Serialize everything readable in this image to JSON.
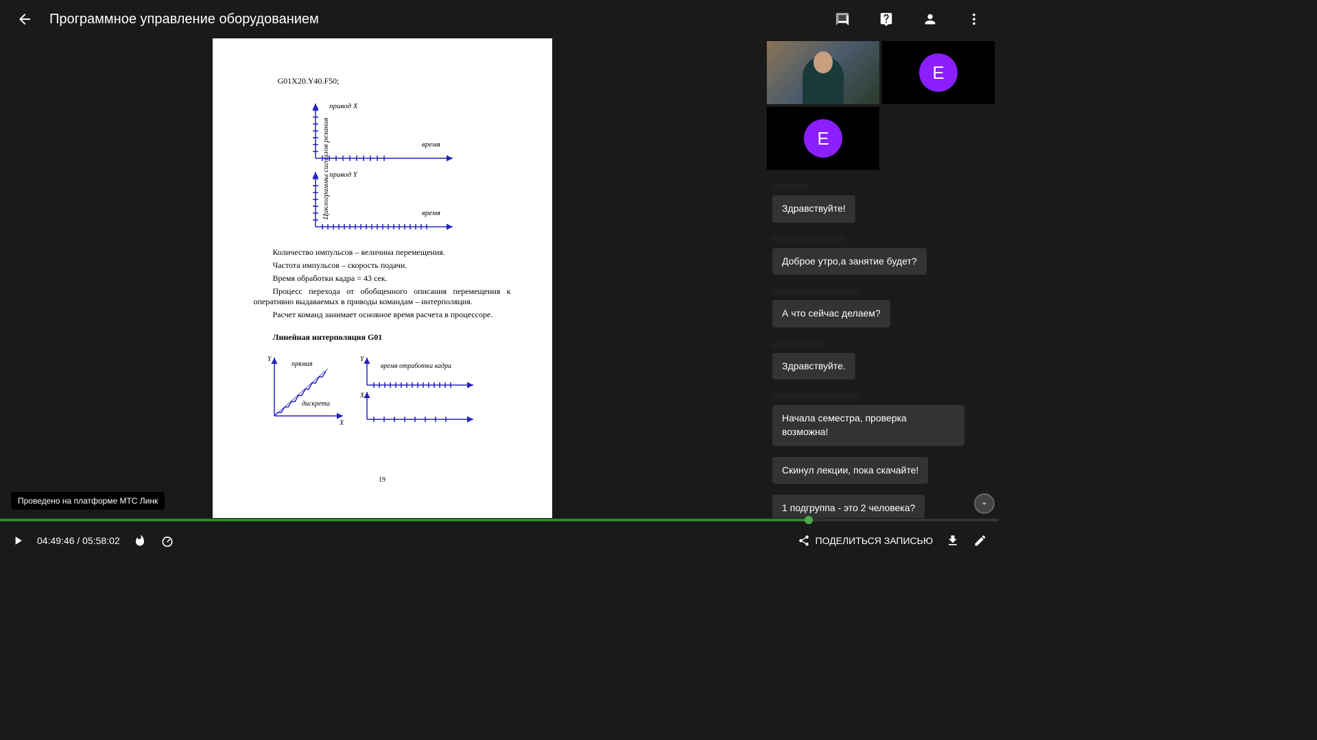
{
  "header": {
    "title": "Программное управление оборудованием"
  },
  "document": {
    "code_line": "G01X20.Y40.F50;",
    "vert_label": "Циклограммы сигналов резания",
    "axis_top_label": "привод Х",
    "axis_bottom_label": "привод Y",
    "axis_time": "время",
    "text1": "Количество импульсов – величина перемещения.",
    "text2": "Частота импульсов – скорость подачи.",
    "text3": "Время обработки кадра = 43 сек.",
    "text4": "Процесс перехода от обобщенного описания перемещения к оперативно выдаваемых в приводы командам – интерполяция.",
    "text5": "Расчет команд занимает основное время расчета в процессоре.",
    "heading": "Линейная интерполяция G01",
    "d2_label1": "прямая",
    "d2_label2": "дискрета",
    "d2_label3": "время отработки кадра",
    "page_number": "19"
  },
  "platform_badge": "Проведено на платформе МТС Линк",
  "participants": {
    "avatar_letter": "Е"
  },
  "chat": [
    {
      "name": "————",
      "text": "Здравствуйте!"
    },
    {
      "name": "————————",
      "text": "Доброе утро,а занятие будет?"
    },
    {
      "name": "——————————",
      "text": "А что сейчас делаем?"
    },
    {
      "name": "——————",
      "text": "Здравствуйте."
    },
    {
      "name": "——————————",
      "text": "Начала семестра, проверка возможна!"
    },
    {
      "name": "",
      "text": "Скинул лекции, пока скачайте!"
    },
    {
      "name": "",
      "text": "1 подгруппа - это 2 человека?"
    }
  ],
  "controls": {
    "current_time": "04:49:46",
    "total_time": "05:58:02",
    "separator": " / ",
    "share_label": "ПОДЕЛИТЬСЯ ЗАПИСЬЮ"
  }
}
